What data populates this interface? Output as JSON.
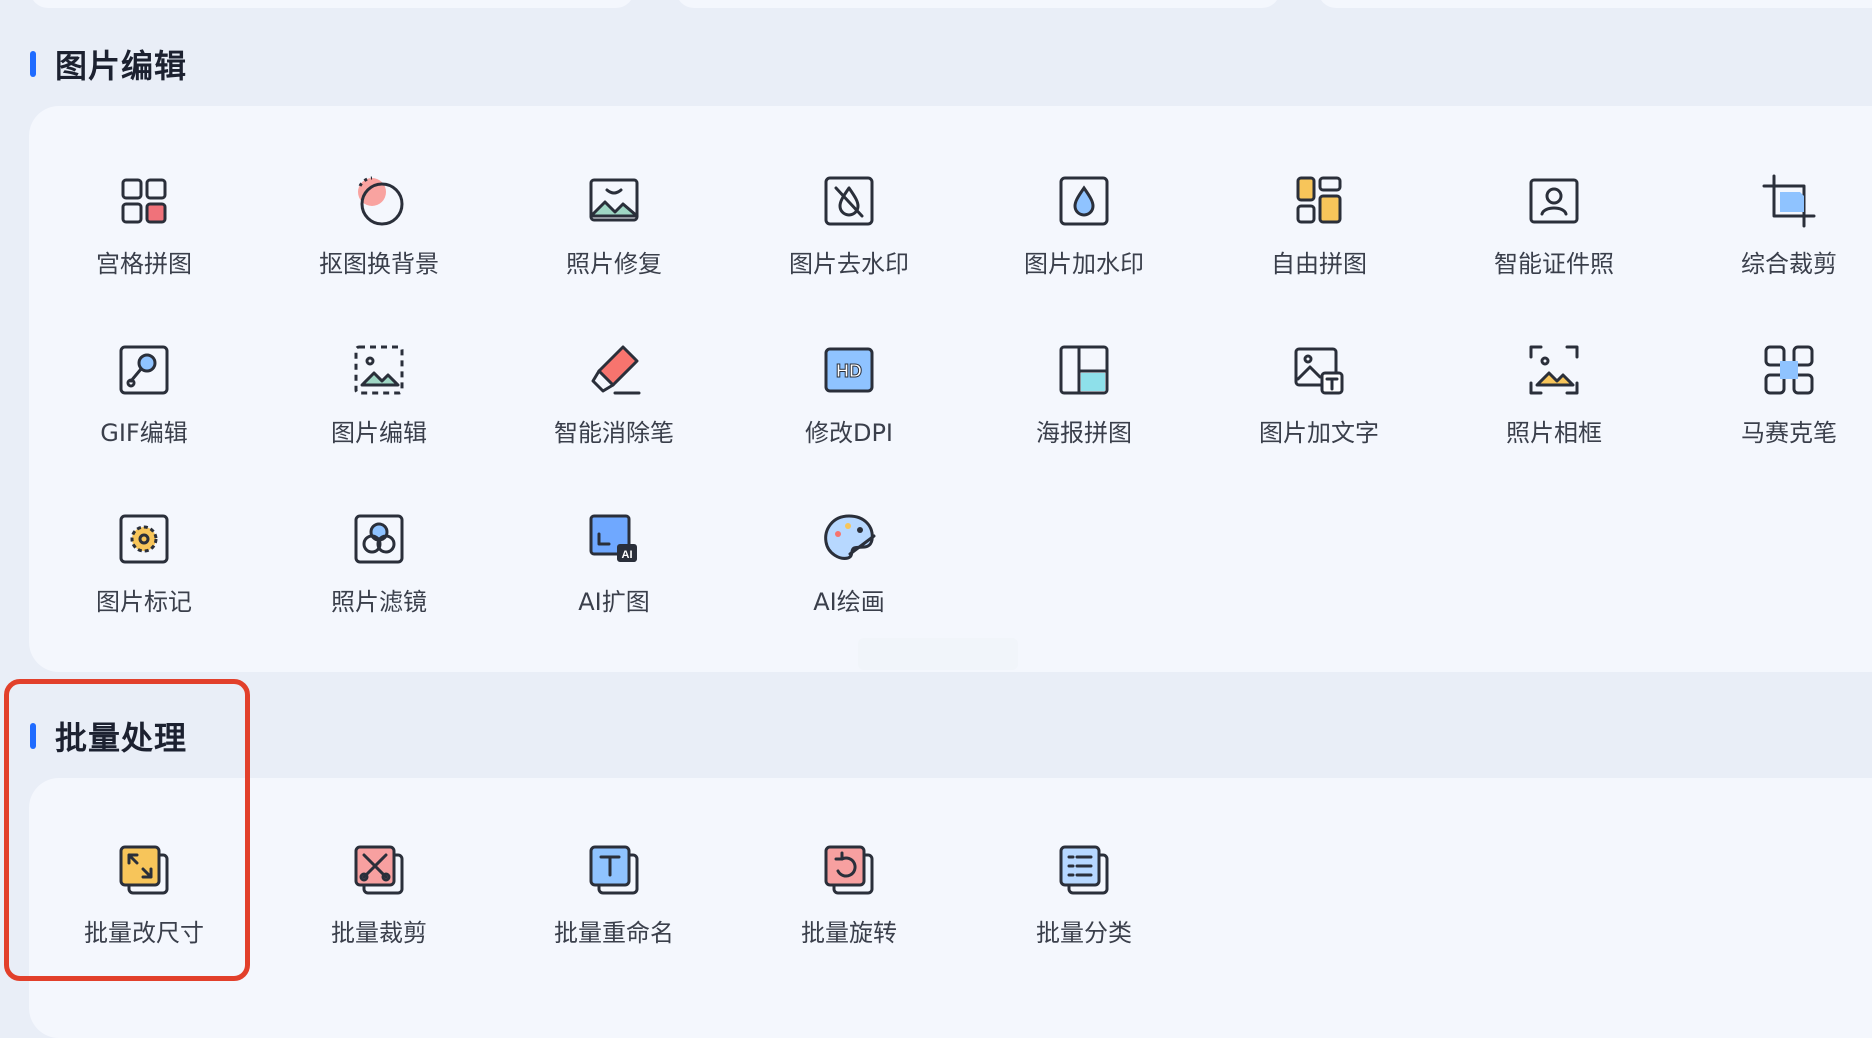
{
  "sections": {
    "edit": {
      "title": "图片编辑"
    },
    "batch": {
      "title": "批量处理"
    }
  },
  "edit_tools": [
    {
      "label": "宫格拼图",
      "icon": "grid-collage-icon"
    },
    {
      "label": "抠图换背景",
      "icon": "cutout-background-icon"
    },
    {
      "label": "照片修复",
      "icon": "photo-repair-icon"
    },
    {
      "label": "图片去水印",
      "icon": "remove-watermark-icon"
    },
    {
      "label": "图片加水印",
      "icon": "add-watermark-icon"
    },
    {
      "label": "自由拼图",
      "icon": "free-collage-icon"
    },
    {
      "label": "智能证件照",
      "icon": "id-photo-icon"
    },
    {
      "label": "综合裁剪",
      "icon": "crop-icon"
    },
    {
      "label": "GIF编辑",
      "icon": "gif-edit-icon"
    },
    {
      "label": "图片编辑",
      "icon": "image-edit-icon"
    },
    {
      "label": "智能消除笔",
      "icon": "eraser-pen-icon"
    },
    {
      "label": "修改DPI",
      "icon": "hd-dpi-icon"
    },
    {
      "label": "海报拼图",
      "icon": "poster-collage-icon"
    },
    {
      "label": "图片加文字",
      "icon": "add-text-icon"
    },
    {
      "label": "照片相框",
      "icon": "photo-frame-icon"
    },
    {
      "label": "马赛克笔",
      "icon": "mosaic-pen-icon"
    },
    {
      "label": "图片标记",
      "icon": "image-mark-icon"
    },
    {
      "label": "照片滤镜",
      "icon": "photo-filter-icon"
    },
    {
      "label": "AI扩图",
      "icon": "ai-expand-icon"
    },
    {
      "label": "AI绘画",
      "icon": "ai-paint-icon"
    }
  ],
  "batch_tools": [
    {
      "label": "批量改尺寸",
      "icon": "batch-resize-icon"
    },
    {
      "label": "批量裁剪",
      "icon": "batch-crop-icon"
    },
    {
      "label": "批量重命名",
      "icon": "batch-rename-icon"
    },
    {
      "label": "批量旋转",
      "icon": "batch-rotate-icon"
    },
    {
      "label": "批量分类",
      "icon": "batch-classify-icon"
    }
  ],
  "colors": {
    "accent": "#1f6bff",
    "highlight": "#e2402b",
    "background": "#e9eef7",
    "panel": "#f4f7fd"
  }
}
